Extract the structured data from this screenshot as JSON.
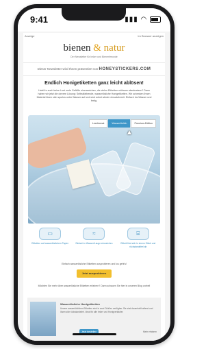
{
  "status": {
    "time": "9:41"
  },
  "email": {
    "meta_left": "Anzeige",
    "meta_right": "Im Browser anzeigen",
    "brand": {
      "part1": "bienen",
      "amp": "&",
      "part2": "natur"
    },
    "tagline": "Der Newsletter für Imker und Bienenfreunde",
    "sponsor_prefix": "Dieser Newsletter wird Ihnen präsentiert von",
    "sponsor_name": "HONEYSTICKERS.COM",
    "headline": "Endlich Honigetiketten ganz leicht ablösen!",
    "body": "Habt ihr auch keine Lust mehr Gefäße einzuweichen, die vielen Etiketten mühsam abzukratzen? Dann haben wir jetzt die clevere Lösung: Selbstklebende, wasserlösliche Honigetiketten. Wir schenken Ihnen Material lösen sich spurlos unter Wasser auf und sind sofort wieder einsatzbereit. Einfach ins Wasser und fertig.",
    "tabs": [
      {
        "label": "Leerformat",
        "active": false
      },
      {
        "label": "Wasserlöslich",
        "active": true
      },
      {
        "label": "Premium-Edition",
        "active": false
      }
    ],
    "features": [
      {
        "icon": "paper-icon",
        "text": "Etiketten auf wasserlöslichem Papier"
      },
      {
        "icon": "water-icon",
        "text": "Einfach in Wasser/Lauge einweichen"
      },
      {
        "icon": "jar-icon",
        "text": "Etikett löst sich in einem Stück und rückstandsfrei ab"
      }
    ],
    "note": "Einfach wasserlösliche Etiketten ausprobieren und los geht's!",
    "cta": "Jetzt ausprobieren",
    "more": "Möchten Sie mehr über wasserlösliche Etiketten erfahren? Dann schauen Sie hier in unseren Blog vorbei!",
    "card": {
      "title": "Wasserlösliche Honigetiketten",
      "desc": "Unsere wasserlöslichen Etiketten sind in zwei Größen verfügbar. Sie sind dauerhaft haftend und lösen sich rückstandsfrei. Ideal für alle Imker und Honigverkäufer.",
      "button": "Jetzt bestellen",
      "more": "Mehr erfahren"
    }
  },
  "colors": {
    "accent": "#3f97c9",
    "cta": "#f2bf2e",
    "brand_gold": "#d59a1c"
  }
}
